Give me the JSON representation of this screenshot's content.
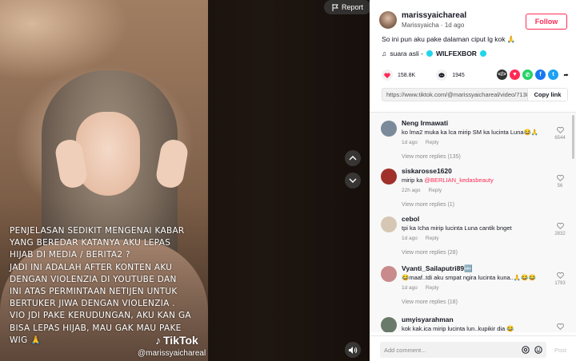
{
  "video": {
    "caption": "PENJELASAN SEDIKIT MENGENAI KABAR\nYANG BEREDAR KATANYA AKU LEPAS\nHIJAB DI MEDIA / BERITA2 ?\nJADI INI ADALAH AFTER KONTEN AKU\nDENGAN VIOLENZIA DI YOUTUBE DAN\nINI ATAS PERMINTAAN NETIJEN UNTUK\nBERTUKER JIWA DENGAN VIOLENZIA .\nVIO JDI PAKE KERUDUNGAN, AKU KAN GA\nBISA LEPAS HIJAB, MAU GAK MAU PAKE\nWIG 🙏",
    "logo_text": "TikTok",
    "watermark": "@marissyaichareal",
    "report_label": "Report"
  },
  "author": {
    "username": "marissyaichareal",
    "display": "Marissyaicha",
    "separator": "·",
    "time": "1d ago",
    "follow_label": "Follow"
  },
  "post": {
    "description": "So ini pun aku pake dalaman ciput lg kok 🙏",
    "music_prefix": "♫",
    "music": "suara asli - ",
    "music_artist": "WILFEXBOR",
    "likes": "158.8K",
    "comments_count": "1945",
    "link": "https://www.tiktok.com/@marissyaichareal/video/71386863...",
    "copy_label": "Copy link"
  },
  "share_icons": [
    {
      "name": "embed-icon",
      "glyph": "</>",
      "color": "#333333"
    },
    {
      "name": "send-to-friends-icon",
      "glyph": "▼",
      "color": "#fe2c55"
    },
    {
      "name": "whatsapp-icon",
      "glyph": "✆",
      "color": "#25d366"
    },
    {
      "name": "facebook-icon",
      "glyph": "f",
      "color": "#1877f2"
    },
    {
      "name": "twitter-icon",
      "glyph": "t",
      "color": "#1da1f2"
    },
    {
      "name": "more-share-icon",
      "glyph": "➦",
      "color": "#ffffff"
    }
  ],
  "comments": [
    {
      "name": "Neng Irmawati",
      "text": "ko lma2 muka ka lca mirip SM ka lucinta Luna😂🙏",
      "time": "1d ago",
      "reply": "Reply",
      "likes": "6544",
      "more": "View more replies (135)",
      "avatar": "#7a8a9a"
    },
    {
      "name": "siskarosse1620",
      "text_pre": "mirip ka ",
      "mention": "@BERLIAN_kedasbeauty",
      "time": "22h ago",
      "reply": "Reply",
      "likes": "56",
      "more": "View more replies (1)",
      "avatar": "#a0302a"
    },
    {
      "name": "cebol",
      "text": "tpi ka Icha mirip lucinta Luna cantik bnget",
      "time": "1d ago",
      "reply": "Reply",
      "likes": "2832",
      "more": "View more replies (28)",
      "avatar": "#d6c7b4"
    },
    {
      "name": "Vyanti_Sailaputri89🔤",
      "text": "😂maaf..tdi aku smpat ngira lucinta kuna..🙏😂😂",
      "time": "1d ago",
      "reply": "Reply",
      "likes": "1793",
      "more": "View more replies (18)",
      "avatar": "#c88a8a"
    },
    {
      "name": "umyisyarahman",
      "text": "kok kak.ica mirip lucinta lun..kupikir dia 😂",
      "time": "",
      "reply": "",
      "likes": "",
      "more": "",
      "avatar": "#6a7a6a"
    }
  ],
  "add_comment": {
    "placeholder": "Add comment...",
    "post_label": "Post"
  },
  "colors": {
    "accent": "#fe2c55",
    "text": "#161823",
    "muted": "#8a8a8a"
  }
}
